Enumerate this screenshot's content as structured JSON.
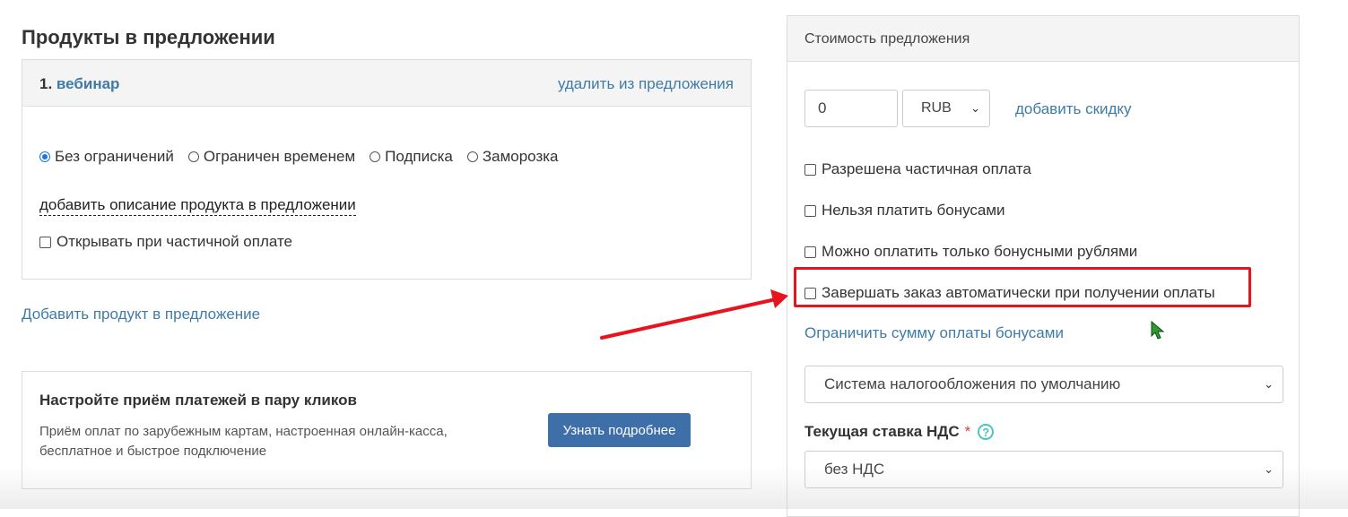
{
  "left": {
    "section_title": "Продукты в предложении",
    "product": {
      "number": "1.",
      "name": "вебинар",
      "remove_link": "удалить из предложения",
      "access_options": [
        {
          "label": "Без ограничений",
          "checked": true
        },
        {
          "label": "Ограничен временем",
          "checked": false
        },
        {
          "label": "Подписка",
          "checked": false
        },
        {
          "label": "Заморозка",
          "checked": false
        }
      ],
      "description_link": "добавить описание продукта в предложении",
      "open_partial_label": "Открывать при частичной оплате"
    },
    "add_product_link": "Добавить продукт в предложение",
    "payments_card": {
      "title": "Настройте приём платежей в пару кликов",
      "text": "Приём оплат по зарубежным картам, настроенная онлайн-касса, бесплатное и быстрое подключение",
      "button_label": "Узнать подробнее"
    }
  },
  "right": {
    "panel_title": "Стоимость предложения",
    "price_value": "0",
    "currency": "RUB",
    "discount_link": "добавить скидку",
    "checkboxes": [
      "Разрешена частичная оплата",
      "Нельзя платить бонусами",
      "Можно оплатить только бонусными рублями",
      "Завершать заказ автоматически при получении оплаты"
    ],
    "limit_bonus_link": "Ограничить сумму оплаты бонусами",
    "tax_system": "Система налогообложения по умолчанию",
    "vat_label": "Текущая ставка НДС",
    "vat_required_mark": "*",
    "vat_help": "?",
    "vat_value": "без НДС"
  },
  "colors": {
    "link": "#3f7ba7",
    "button": "#3f6fa9",
    "highlight": "#e8131d",
    "cursor": "#2e9c2e"
  }
}
